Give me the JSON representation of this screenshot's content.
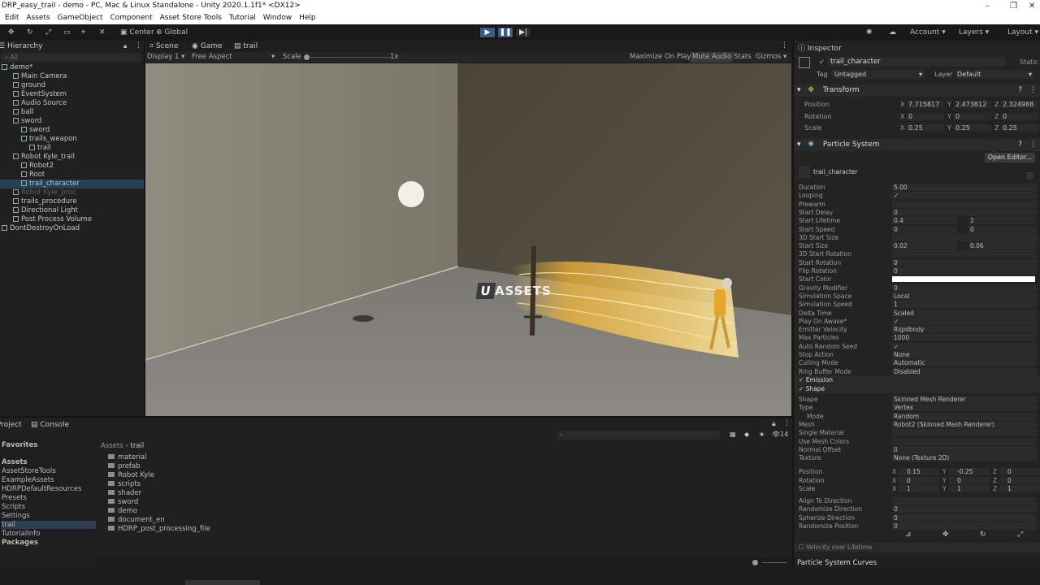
{
  "window": {
    "title": "DRP_easy_trail - demo - PC, Mac & Linux Standalone - Unity 2020.1.1f1* <DX12>"
  },
  "menu": [
    "Edit",
    "Assets",
    "GameObject",
    "Component",
    "Asset Store Tools",
    "Tutorial",
    "Window",
    "Help"
  ],
  "toolbar": {
    "center": "Center",
    "global": "Global",
    "account": "Account",
    "layers": "Layers",
    "layout": "Layout"
  },
  "hierarchy": {
    "tab": "Hierarchy",
    "search_placeholder": "All",
    "rows": [
      {
        "label": "demo*",
        "indent": 0
      },
      {
        "label": "Main Camera",
        "indent": 1
      },
      {
        "label": "ground",
        "indent": 1
      },
      {
        "label": "EventSystem",
        "indent": 1
      },
      {
        "label": "Audio Source",
        "indent": 1
      },
      {
        "label": "ball",
        "indent": 1
      },
      {
        "label": "sword",
        "indent": 1
      },
      {
        "label": "sword",
        "indent": 2
      },
      {
        "label": "trails_weapon",
        "indent": 2
      },
      {
        "label": "trail",
        "indent": 3
      },
      {
        "label": "Robot Kyle_trail",
        "indent": 1
      },
      {
        "label": "Robot2",
        "indent": 2
      },
      {
        "label": "Root",
        "indent": 2
      },
      {
        "label": "trail_character",
        "indent": 2,
        "selected": true
      },
      {
        "label": "Robot Kyle_proc",
        "indent": 1,
        "dim": true
      },
      {
        "label": "trails_procedure",
        "indent": 1
      },
      {
        "label": "Directional Light",
        "indent": 1
      },
      {
        "label": "Post Process Volume",
        "indent": 1
      },
      {
        "label": "DontDestroyOnLoad",
        "indent": 0
      }
    ]
  },
  "scene_tabs": {
    "scene": "Scene",
    "game": "Game",
    "trail": "trail"
  },
  "game_bar": {
    "display": "Display 1",
    "aspect": "Free Aspect",
    "scale_label": "Scale",
    "scale_value": "1x",
    "maximize": "Maximize On Play",
    "mute": "Mute Audio",
    "stats": "Stats",
    "gizmos": "Gizmos"
  },
  "watermark": "ASSETS",
  "project": {
    "tab": "Project",
    "console_tab": "Console",
    "favorites": "Favorites",
    "assets_root": "Assets",
    "left_items": [
      "AssetStoreTools",
      "ExampleAssets",
      "HDRPDefaultResources",
      "Presets",
      "Scripts",
      "Settings",
      "trail",
      "TutorialInfo"
    ],
    "packages": "Packages",
    "breadcrumb": [
      "Assets",
      "trail"
    ],
    "files": [
      "material",
      "prefab",
      "Robot Kyle",
      "scripts",
      "shader",
      "sword",
      "demo",
      "document_en",
      "HDRP_post_processing_file"
    ],
    "hidden_count": "14"
  },
  "inspector": {
    "tab": "Inspector",
    "object_name": "trail_character",
    "static_label": "Static",
    "tag_label": "Tag",
    "tag_value": "Untagged",
    "layer_label": "Layer",
    "layer_value": "Default",
    "transform": {
      "title": "Transform",
      "rows": [
        {
          "label": "Position",
          "x": "7.715817",
          "y": "2.473812",
          "z": "2.324988"
        },
        {
          "label": "Rotation",
          "x": "0",
          "y": "0",
          "z": "0"
        },
        {
          "label": "Scale",
          "x": "0.25",
          "y": "0.25",
          "z": "0.25"
        }
      ]
    },
    "particle_system": {
      "title": "Particle System",
      "open_editor": "Open Editor...",
      "subtitle": "trail_character",
      "props": [
        {
          "label": "Duration",
          "v1": "5.00"
        },
        {
          "label": "Looping",
          "v1": "✓"
        },
        {
          "label": "Prewarm",
          "v1": ""
        },
        {
          "label": "Start Delay",
          "v1": "0"
        },
        {
          "label": "Start Lifetime",
          "v1": "0.4",
          "v2": "2"
        },
        {
          "label": "Start Speed",
          "v1": "0",
          "v2": "0"
        },
        {
          "label": "3D Start Size",
          "v1": ""
        },
        {
          "label": "Start Size",
          "v1": "0.02",
          "v2": "0.06"
        },
        {
          "label": "3D Start Rotation",
          "v1": ""
        },
        {
          "label": "Start Rotation",
          "v1": "0"
        },
        {
          "label": "Flip Rotation",
          "v1": "0"
        },
        {
          "label": "Start Color",
          "v1": ""
        },
        {
          "label": "Gravity Modifier",
          "v1": "0"
        },
        {
          "label": "Simulation Space",
          "v1": "Local"
        },
        {
          "label": "Simulation Speed",
          "v1": "1"
        },
        {
          "label": "Delta Time",
          "v1": "Scaled"
        },
        {
          "label": "Play On Awake*",
          "v1": "✓"
        },
        {
          "label": "Emitter Velocity",
          "v1": "Rigidbody"
        },
        {
          "label": "Max Particles",
          "v1": "1000"
        },
        {
          "label": "Auto Random Seed",
          "v1": "✓"
        },
        {
          "label": "Stop Action",
          "v1": "None"
        },
        {
          "label": "Culling Mode",
          "v1": "Automatic"
        },
        {
          "label": "Ring Buffer Mode",
          "v1": "Disabled"
        }
      ],
      "emission": "Emission",
      "shape": "Shape",
      "shape_props": [
        {
          "label": "Shape",
          "v1": "Skinned Mesh Renderer"
        },
        {
          "label": "Type",
          "v1": "Vertex"
        },
        {
          "label": "Mode",
          "v1": "Random"
        },
        {
          "label": "Mesh",
          "v1": "Robot2 (Skinned Mesh Renderer)"
        },
        {
          "label": "Single Material",
          "v1": ""
        },
        {
          "label": "Use Mesh Colors",
          "v1": ""
        },
        {
          "label": "Normal Offset",
          "v1": "0"
        },
        {
          "label": "Texture",
          "v1": "None (Texture 2D)"
        }
      ],
      "shape_xyz": [
        {
          "label": "Position",
          "x": "0.15",
          "y": "-0.25",
          "z": "0"
        },
        {
          "label": "Rotation",
          "x": "0",
          "y": "0",
          "z": "0"
        },
        {
          "label": "Scale",
          "x": "1",
          "y": "1",
          "z": "1"
        }
      ],
      "shape_props2": [
        {
          "label": "Align To Direction",
          "v1": ""
        },
        {
          "label": "Randomize Direction",
          "v1": "0"
        },
        {
          "label": "Spherize Direction",
          "v1": "0"
        },
        {
          "label": "Randomize Position",
          "v1": "0"
        }
      ],
      "velocity_lifetime": "Velocity over Lifetime",
      "curves": "Particle System Curves"
    }
  }
}
